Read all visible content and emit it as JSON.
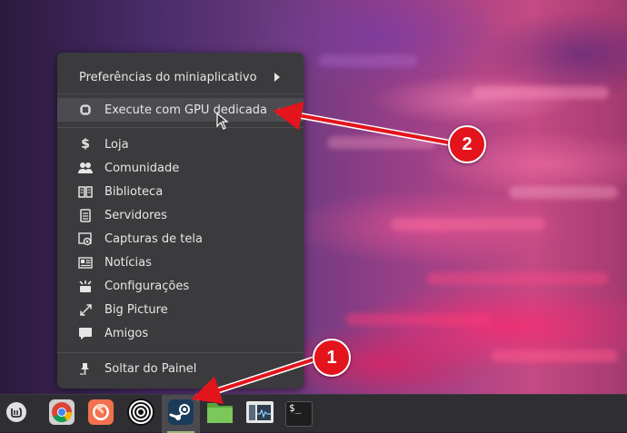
{
  "menu": {
    "top_item": {
      "label": "Preferências do miniaplicativo",
      "icon": "chevron-right-icon"
    },
    "gpu_item": {
      "label": "Execute com GPU dedicada",
      "icon": "chip-icon"
    },
    "items": [
      {
        "label": "Loja",
        "icon": "dollar-icon"
      },
      {
        "label": "Comunidade",
        "icon": "people-icon"
      },
      {
        "label": "Biblioteca",
        "icon": "book-icon"
      },
      {
        "label": "Servidores",
        "icon": "server-icon"
      },
      {
        "label": "Capturas de tela",
        "icon": "screenshot-icon"
      },
      {
        "label": "Notícias",
        "icon": "news-icon"
      },
      {
        "label": "Configurações",
        "icon": "settings-icon"
      },
      {
        "label": "Big Picture",
        "icon": "expand-icon"
      },
      {
        "label": "Amigos",
        "icon": "chat-icon"
      }
    ],
    "bottom_item": {
      "label": "Soltar do Painel",
      "icon": "unpin-icon"
    }
  },
  "taskbar": {
    "apps": [
      {
        "name": "linux-mint-menu-icon"
      },
      {
        "name": "chrome-icon"
      },
      {
        "name": "firefox-icon"
      },
      {
        "name": "circles-app-icon"
      },
      {
        "name": "steam-icon",
        "active": true
      },
      {
        "name": "files-icon"
      },
      {
        "name": "system-monitor-icon"
      },
      {
        "name": "terminal-icon",
        "text": "$_"
      }
    ]
  },
  "annotations": {
    "badge_1": "1",
    "badge_2": "2",
    "arrow_color": "#e3141c"
  }
}
